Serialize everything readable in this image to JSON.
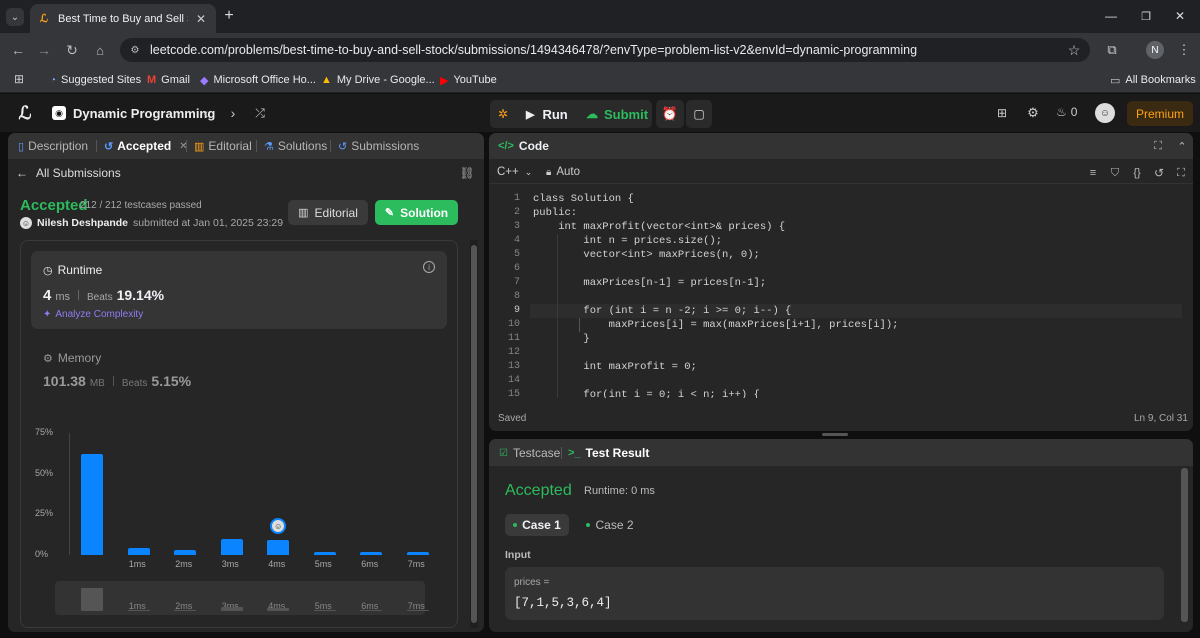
{
  "browser": {
    "tab_title": "Best Time to Buy and Sell Stock",
    "url": "leetcode.com/problems/best-time-to-buy-and-sell-stock/submissions/1494346478/?envType=problem-list-v2&envId=dynamic-programming",
    "profile_initial": "N",
    "bookmarks": [
      "Suggested Sites",
      "Gmail",
      "Microsoft Office Ho...",
      "My Drive - Google...",
      "YouTube"
    ],
    "all_bookmarks": "All Bookmarks"
  },
  "topbar": {
    "problem_list": "Dynamic Programming",
    "run": "Run",
    "submit": "Submit",
    "streak": "0",
    "premium": "Premium"
  },
  "left": {
    "tabs": [
      "Description",
      "Accepted",
      "Editorial",
      "Solutions",
      "Submissions"
    ],
    "back": "All Submissions",
    "status": "Accepted",
    "testcases": "212 / 212 testcases passed",
    "user": "Nilesh Deshpande",
    "submitted": "submitted at Jan 01, 2025 23:29",
    "editorial_btn": "Editorial",
    "solution_btn": "Solution",
    "runtime_title": "Runtime",
    "runtime_value": "4",
    "runtime_unit": "ms",
    "beats_label": "Beats",
    "runtime_beats": "19.14%",
    "analyze": "Analyze Complexity",
    "memory_title": "Memory",
    "memory_value": "101.38",
    "memory_unit": "MB",
    "memory_beats": "5.15%"
  },
  "chart_data": {
    "type": "bar",
    "yticks": [
      "75%",
      "50%",
      "25%",
      "0%"
    ],
    "ylim": [
      0,
      75
    ],
    "categories": [
      "",
      "1ms",
      "2ms",
      "3ms",
      "4ms",
      "5ms",
      "6ms",
      "7ms"
    ],
    "values": [
      62,
      4,
      3,
      10,
      9,
      2,
      2,
      2
    ],
    "highlight": "4ms",
    "color": "#0a84ff"
  },
  "code": {
    "title": "Code",
    "language": "C++",
    "mode": "Auto",
    "lines": [
      "class Solution {",
      "public:",
      "    int maxProfit(vector<int>& prices) {",
      "        int n = prices.size();",
      "        vector<int> maxPrices(n, 0);",
      "",
      "        maxPrices[n-1] = prices[n-1];",
      "",
      "        for (int i = n -2; i >= 0; i--) {",
      "            maxPrices[i] = max(maxPrices[i+1], prices[i]);",
      "        }",
      "",
      "        int maxProfit = 0;",
      "",
      "        for(int i = 0; i < n; i++) {"
    ],
    "saved": "Saved",
    "cursor": "Ln 9, Col 31"
  },
  "result": {
    "testcase_tab": "Testcase",
    "result_tab": "Test Result",
    "status": "Accepted",
    "runtime": "Runtime: 0 ms",
    "case1": "Case 1",
    "case2": "Case 2",
    "input_label": "Input",
    "var_name": "prices =",
    "var_value": "[7,1,5,3,6,4]"
  }
}
